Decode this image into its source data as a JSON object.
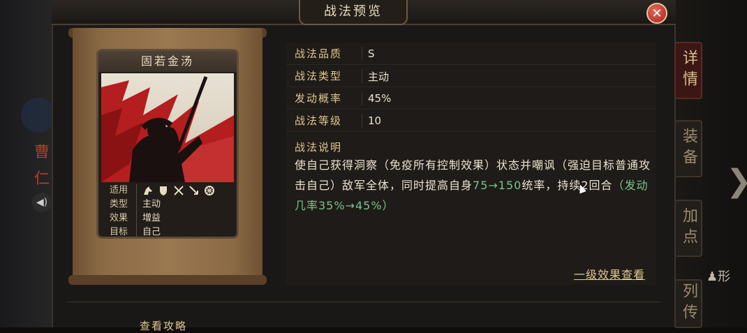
{
  "window": {
    "title": "战法预览"
  },
  "background": {
    "left_name": "曹仁",
    "right_label": "形",
    "side_tabs": [
      "详情",
      "装备",
      "加点",
      "列传"
    ]
  },
  "card": {
    "name": "固若金汤",
    "rows": [
      {
        "key": "适用",
        "icons": [
          "cavalry-icon",
          "shield-icon",
          "crossed-swords-icon",
          "arrow-icon",
          "wheel-icon"
        ]
      },
      {
        "key": "类型",
        "value": "主动"
      },
      {
        "key": "效果",
        "value": "增益"
      },
      {
        "key": "目标",
        "value": "自己"
      }
    ]
  },
  "info": [
    {
      "key": "战法品质",
      "value": "S"
    },
    {
      "key": "战法类型",
      "value": "主动"
    },
    {
      "key": "发动概率",
      "value": "45%"
    },
    {
      "key": "战法等级",
      "value": "10"
    }
  ],
  "description": {
    "label": "战法说明",
    "part1": "使自己获得洞察（免疫所有控制效果）状态并嘲讽（强迫目标普通攻击自己）敌军全体，同时提高自身",
    "highlight1": "75→150",
    "part2": "统率，持续2回合",
    "highlight2": "（发动几率35%→45%）"
  },
  "detail_link": "一级效果查看",
  "guide_link": "查看攻略",
  "colors": {
    "accent": "#e0c890",
    "highlight": "#79c58c",
    "close": "#c0392b"
  }
}
